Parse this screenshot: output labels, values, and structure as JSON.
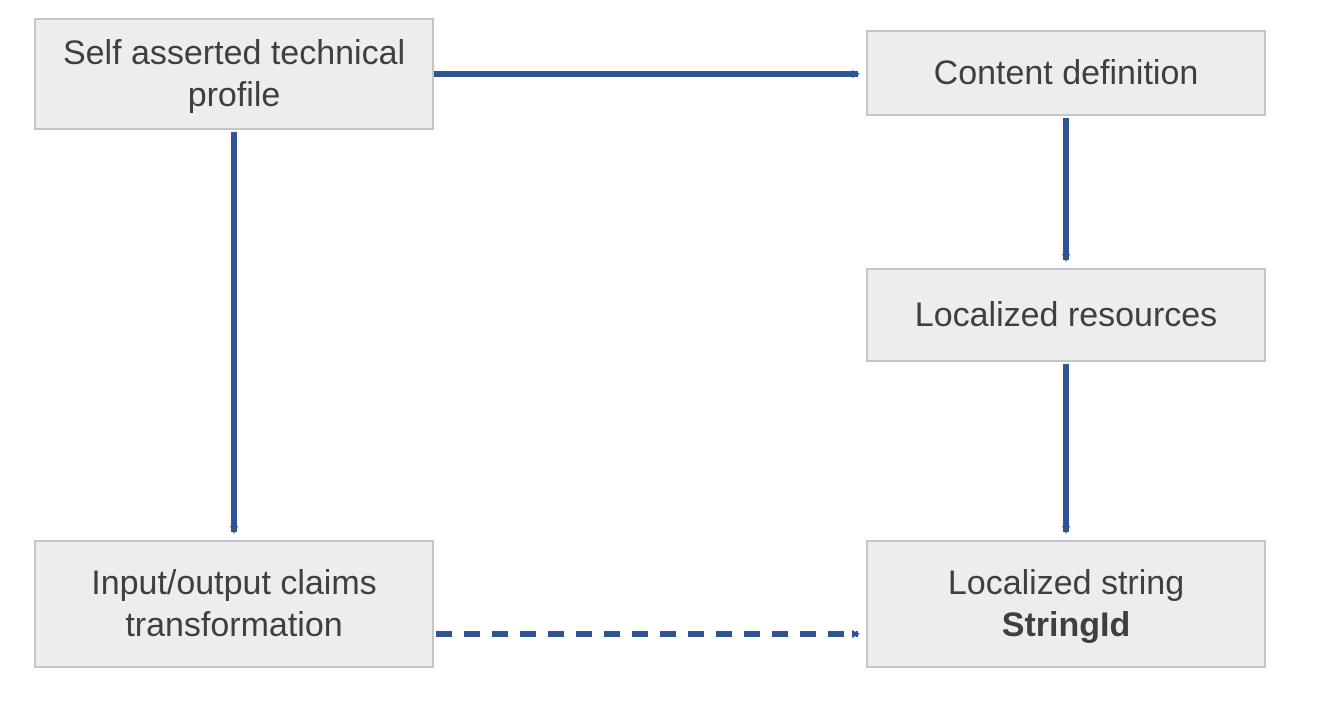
{
  "diagram": {
    "nodes": {
      "self_asserted": {
        "label": "Self asserted technical profile"
      },
      "content_definition": {
        "label": "Content definition"
      },
      "localized_resources": {
        "label": "Localized resources"
      },
      "claims_transformation": {
        "label": "Input/output claims transformation"
      },
      "localized_string": {
        "label": "Localized string",
        "sub": "StringId"
      }
    },
    "edges": [
      {
        "from": "self_asserted",
        "to": "content_definition",
        "style": "solid"
      },
      {
        "from": "content_definition",
        "to": "localized_resources",
        "style": "solid"
      },
      {
        "from": "localized_resources",
        "to": "localized_string",
        "style": "solid"
      },
      {
        "from": "self_asserted",
        "to": "claims_transformation",
        "style": "solid"
      },
      {
        "from": "claims_transformation",
        "to": "localized_string",
        "style": "dashed"
      }
    ],
    "colors": {
      "arrow": "#2f5496",
      "box_fill": "#ededed",
      "box_border": "#c5c5c5",
      "text": "#3f3f3f"
    }
  }
}
